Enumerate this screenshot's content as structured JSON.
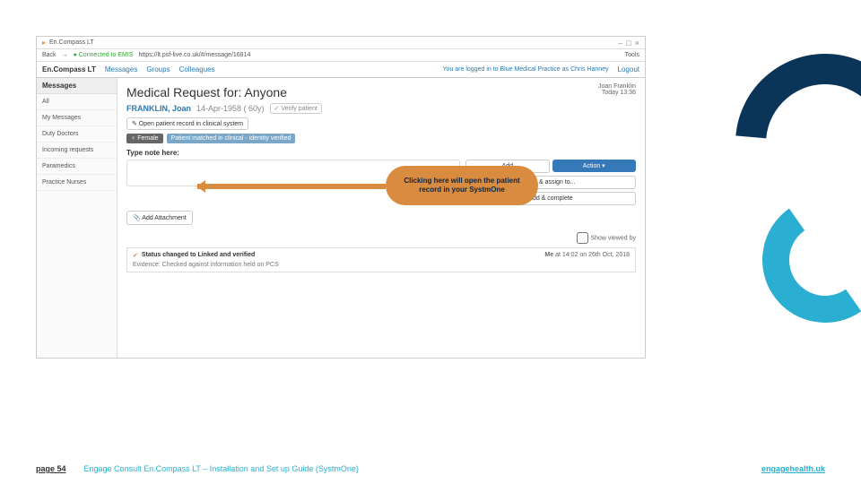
{
  "browser": {
    "tab_title": "En.Compass LT",
    "back": "Back",
    "emis_status": "Connected to EMIS",
    "url": "https://lt.psf-live.co.uk/#/message/16814",
    "tools": "Tools",
    "minimize": "–",
    "maximize": "□",
    "close": "×"
  },
  "navbar": {
    "brand": "En.Compass LT",
    "items": [
      "Messages",
      "Groups",
      "Colleagues"
    ],
    "login_prefix": "You are logged in to ",
    "practice": "Blue Medical Practice",
    "as": " as ",
    "user": "Chris Hanney",
    "logout": "Logout"
  },
  "sidebar": {
    "header": "Messages",
    "items": [
      "All",
      "My Messages",
      "Duty Doctors",
      "Incoming requests",
      "Paramedics",
      "Practice Nurses"
    ]
  },
  "main": {
    "userinfo": {
      "name": "Joan Franklin",
      "time": "Today 13:36"
    },
    "title": "Medical Request for: Anyone",
    "patient_name": "FRANKLIN, Joan",
    "patient_dob": "14-Apr-1958 ( 60y)",
    "verify_btn": "✓ Verify patient",
    "open_record_btn": "✎ Open patient record in clinical system",
    "badge_female": "♀ Female",
    "badge_verified": "Patient matched in clinical - identity verified",
    "note_label": "Type note here:",
    "actions": {
      "add": "Add",
      "assign": "Add & assign to...",
      "complete": "Add & complete",
      "primary": "Action ▾"
    },
    "attach": "📎 Add Attachment",
    "show_viewed": "Show viewed by",
    "status": {
      "text": "Status changed to Linked and verified",
      "meta_prefix": "Me",
      "meta_time": " at 14:02 on 26th Oct, 2018",
      "evidence": "Evidence: Checked against information held on PCS"
    }
  },
  "callout": "Clicking here will open the patient record in your SystmOne",
  "footer": {
    "page": "page 54",
    "doc": "Engage Consult En.Compass LT – Installation and Set up Guide (SystmOne)",
    "website": "engagehealth.uk"
  }
}
